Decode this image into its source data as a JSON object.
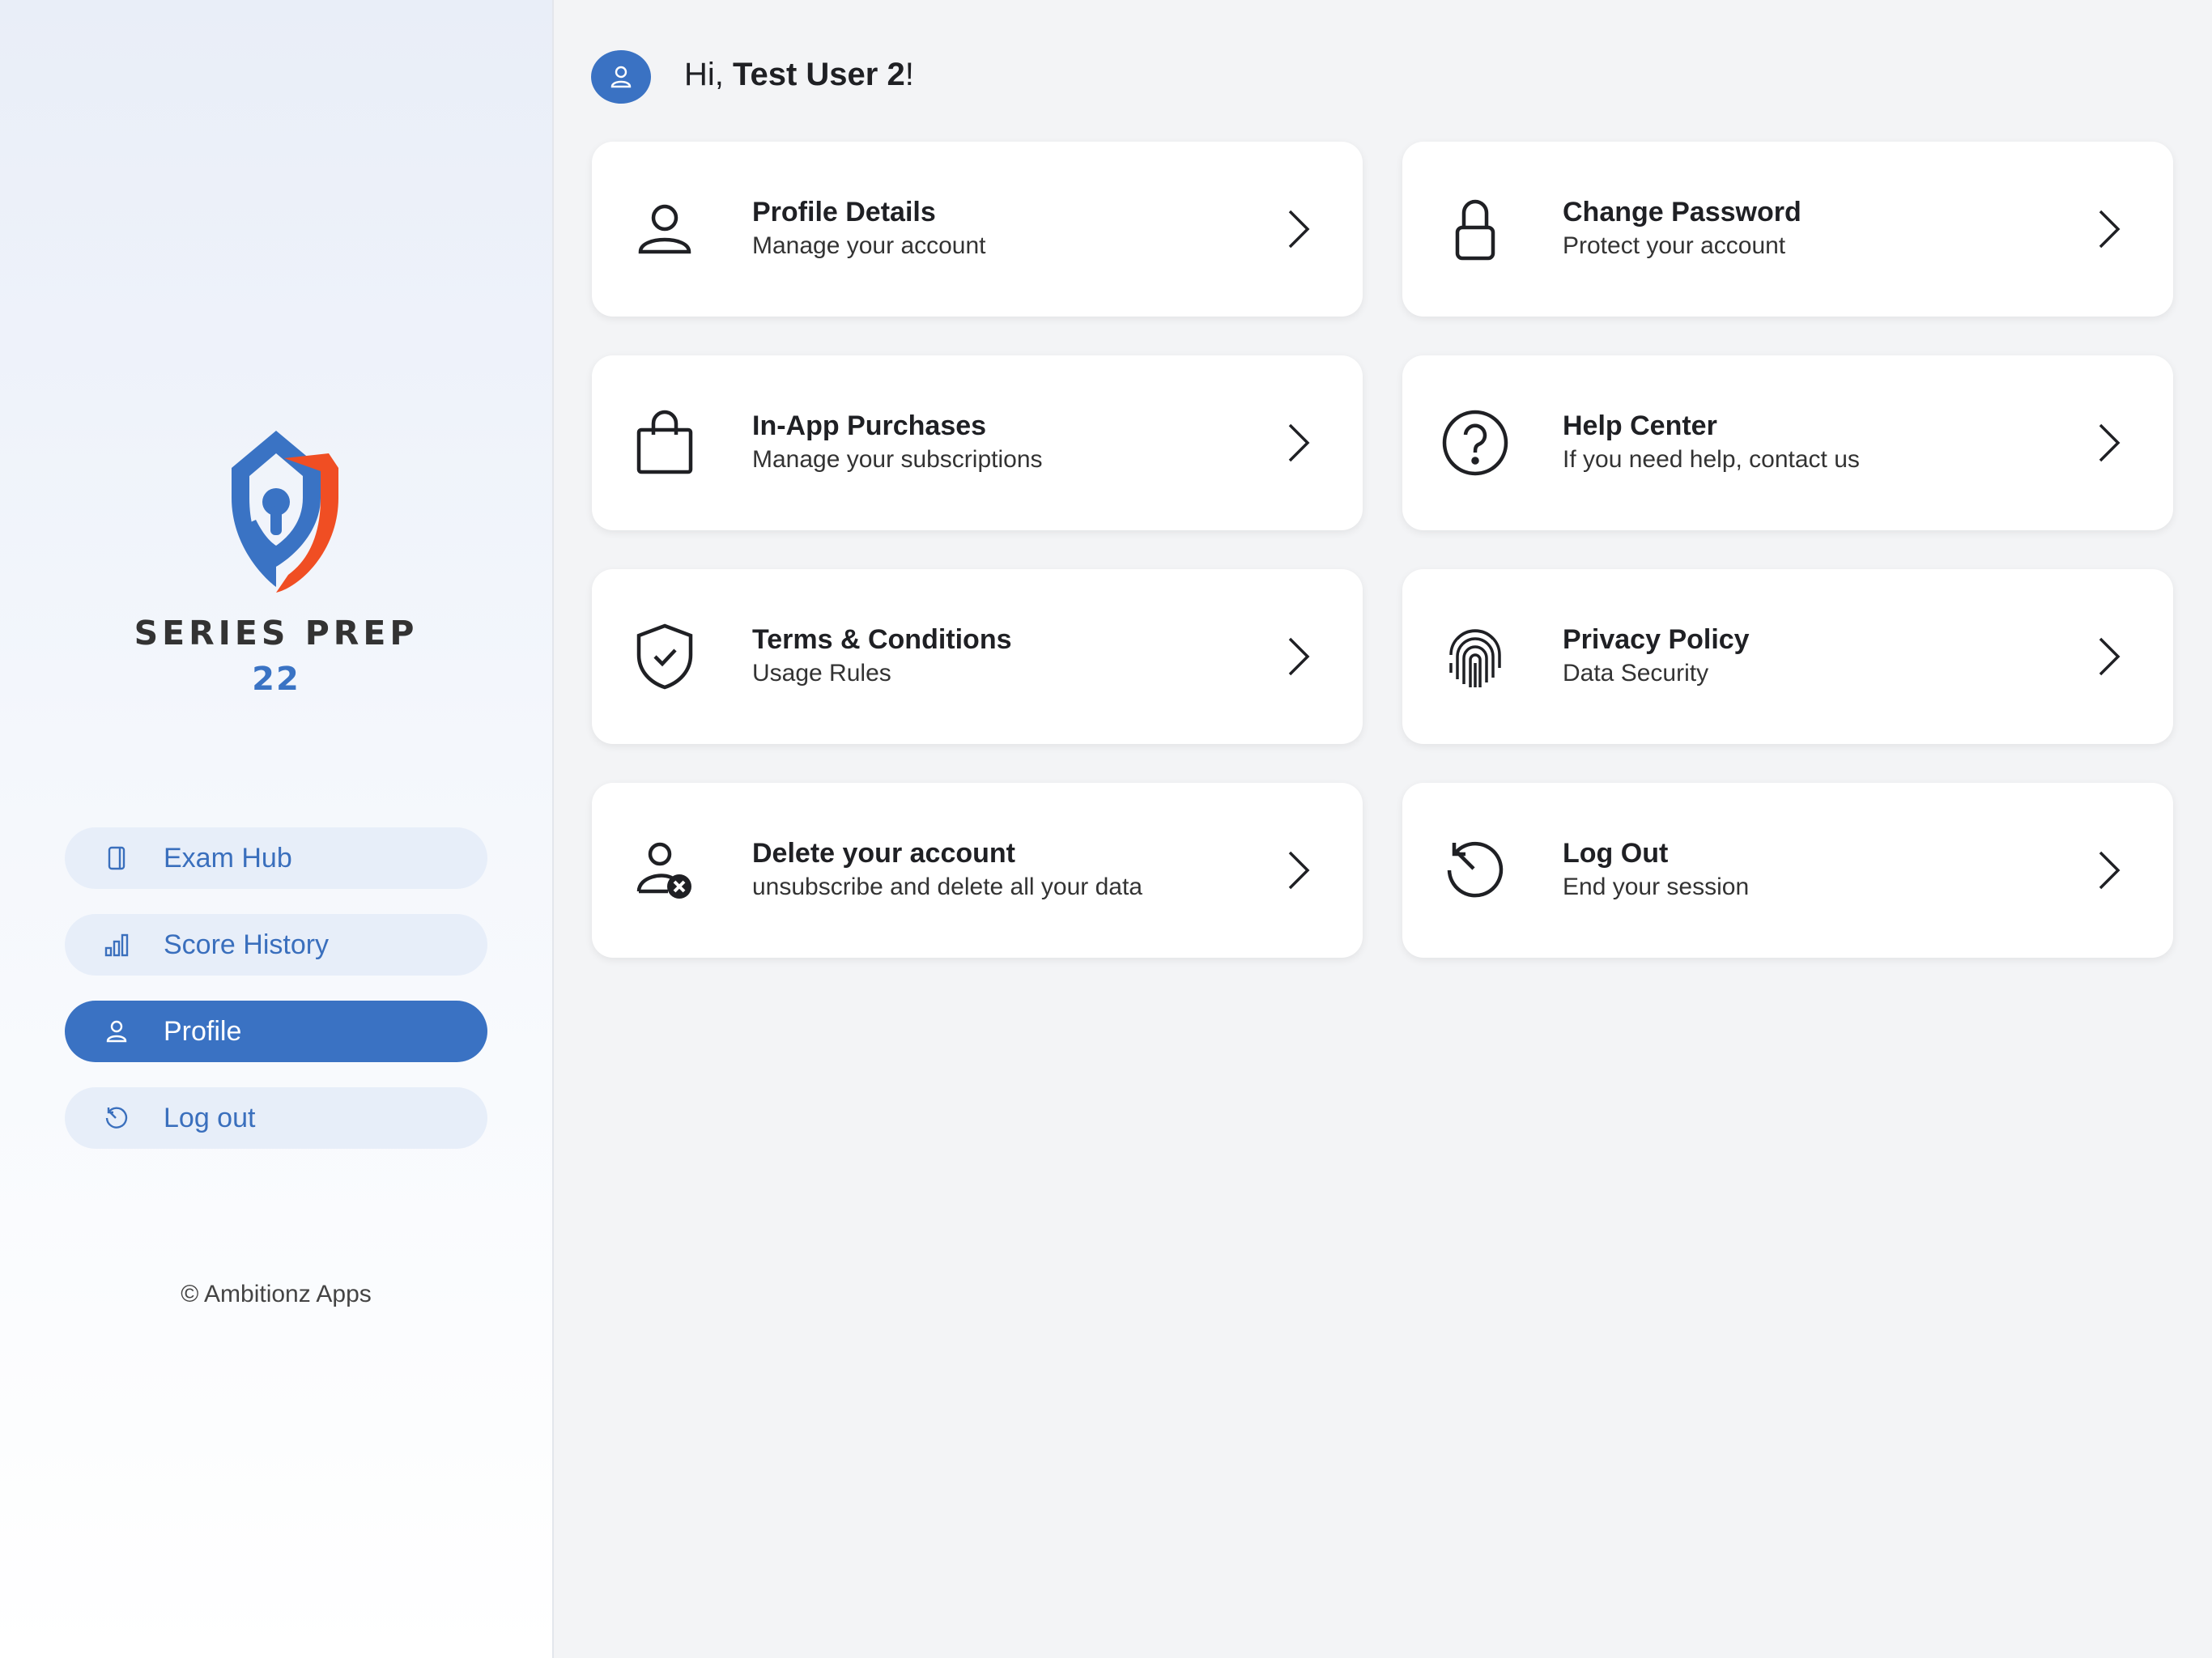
{
  "sidebar": {
    "brand": {
      "title": "SERIES PREP",
      "number": "22"
    },
    "nav": [
      {
        "label": "Exam Hub",
        "icon": "document-icon",
        "active": false
      },
      {
        "label": "Score History",
        "icon": "bar-chart-icon",
        "active": false
      },
      {
        "label": "Profile",
        "icon": "user-icon",
        "active": true
      },
      {
        "label": "Log out",
        "icon": "history-icon",
        "active": false
      }
    ],
    "copyright": "© Ambitionz Apps"
  },
  "header": {
    "greeting_prefix": "Hi, ",
    "user_name": "Test User 2",
    "greeting_suffix": "!"
  },
  "cards": [
    {
      "title": "Profile Details",
      "subtitle": "Manage your account",
      "icon": "user-icon"
    },
    {
      "title": "Change Password",
      "subtitle": "Protect your account",
      "icon": "lock-icon"
    },
    {
      "title": "In-App Purchases",
      "subtitle": "Manage your subscriptions",
      "icon": "shopping-bag-icon"
    },
    {
      "title": "Help Center",
      "subtitle": "If you need help, contact us",
      "icon": "help-circle-icon"
    },
    {
      "title": "Terms & Conditions",
      "subtitle": "Usage Rules",
      "icon": "shield-check-icon"
    },
    {
      "title": "Privacy Policy",
      "subtitle": "Data Security",
      "icon": "fingerprint-icon"
    },
    {
      "title": "Delete your account",
      "subtitle": "unsubscribe and delete all your data",
      "icon": "user-delete-icon"
    },
    {
      "title": "Log Out",
      "subtitle": "End your session",
      "icon": "history-icon"
    }
  ],
  "colors": {
    "accent": "#3a72c3",
    "logo_blue": "#3a73c4",
    "logo_orange": "#f04e23",
    "background": "#f3f4f6"
  }
}
